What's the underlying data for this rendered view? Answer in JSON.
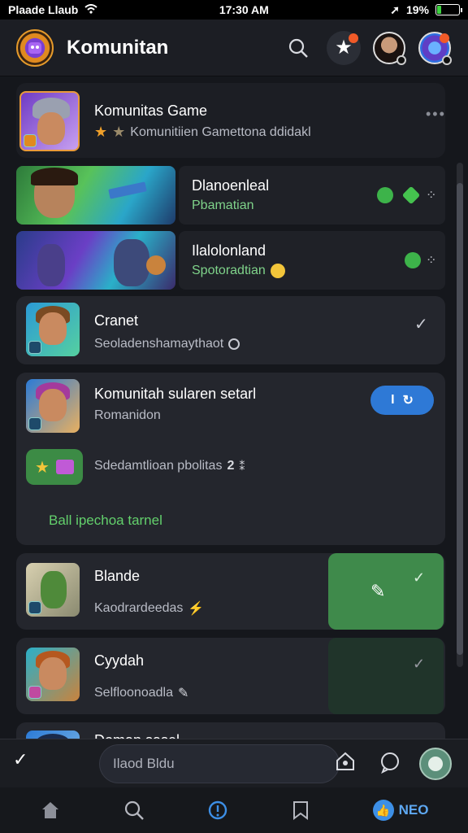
{
  "status_bar": {
    "carrier": "Plaade Llaub",
    "time": "17:30 AM",
    "battery": "19%",
    "battery_level": 0.19
  },
  "header": {
    "title": "Komunitan"
  },
  "community_card": {
    "title": "Komunitas Game",
    "subtitle": "Komunitiien Gamettona ddidakl",
    "rating_stars": 2
  },
  "banners": [
    {
      "title": "Dlanoenleal",
      "subtitle": "Pbamatian"
    },
    {
      "title": "Ilalolonland",
      "subtitle": "Spotoradtian"
    }
  ],
  "list": [
    {
      "title": "Cranet",
      "subtitle": "Seoladenshamaythaot"
    },
    {
      "title": "Komunitah sularen setarl",
      "subtitle": "Romanidon",
      "join_label": "I",
      "tag_text": "Sdedamtlioan pbolitas",
      "tag_count": "2",
      "link": "Ball ipechoa tarnel"
    },
    {
      "title": "Blande",
      "subtitle": "Kaodrardeedas"
    },
    {
      "title": "Cyydah",
      "subtitle": "Selfloonoadla"
    },
    {
      "title": "Doman sasel",
      "subtitle": ""
    }
  ],
  "compose": {
    "placeholder": "Ilaod Bldu"
  },
  "bottom_nav": {
    "feed_label": "NEO"
  },
  "colors": {
    "accent_blue": "#2e79d6",
    "accent_green": "#3f8a4b",
    "link_green": "#63d06c",
    "background": "#15171c"
  }
}
